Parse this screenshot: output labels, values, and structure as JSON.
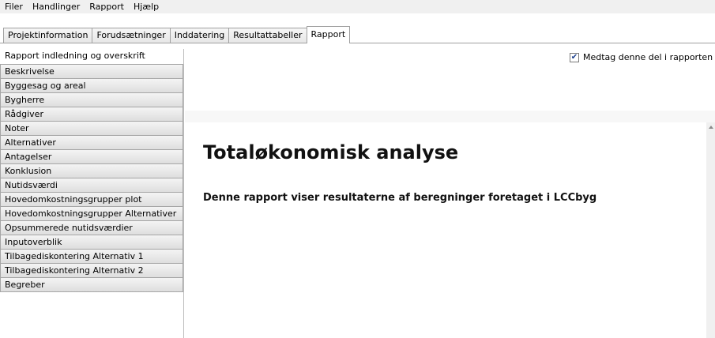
{
  "menubar": {
    "items": [
      "Filer",
      "Handlinger",
      "Rapport",
      "Hjælp"
    ]
  },
  "tabs": [
    {
      "label": "Projektinformation",
      "active": false
    },
    {
      "label": "Forudsætninger",
      "active": false
    },
    {
      "label": "Inddatering",
      "active": false
    },
    {
      "label": "Resultattabeller",
      "active": false
    },
    {
      "label": "Rapport",
      "active": true
    }
  ],
  "sidebar": {
    "title": "Rapport indledning og overskrift",
    "sections": [
      "Beskrivelse",
      "Byggesag og areal",
      "Bygherre",
      "Rådgiver",
      "Noter",
      "Alternativer",
      "Antagelser",
      "Konklusion",
      "Nutidsværdi",
      "Hovedomkostningsgrupper plot",
      "Hovedomkostningsgrupper Alternativer",
      "Opsummerede nutidsværdier",
      "Inputoverblik",
      "Tilbagediskontering Alternativ 1",
      "Tilbagediskontering Alternativ 2",
      "Begreber"
    ]
  },
  "include": {
    "label": "Medtag denne del i rapporten",
    "checked": true
  },
  "report": {
    "title": "Totaløkonomisk analyse",
    "subtitle": "Denne rapport viser resultaterne af beregninger foretaget i LCCbyg"
  }
}
